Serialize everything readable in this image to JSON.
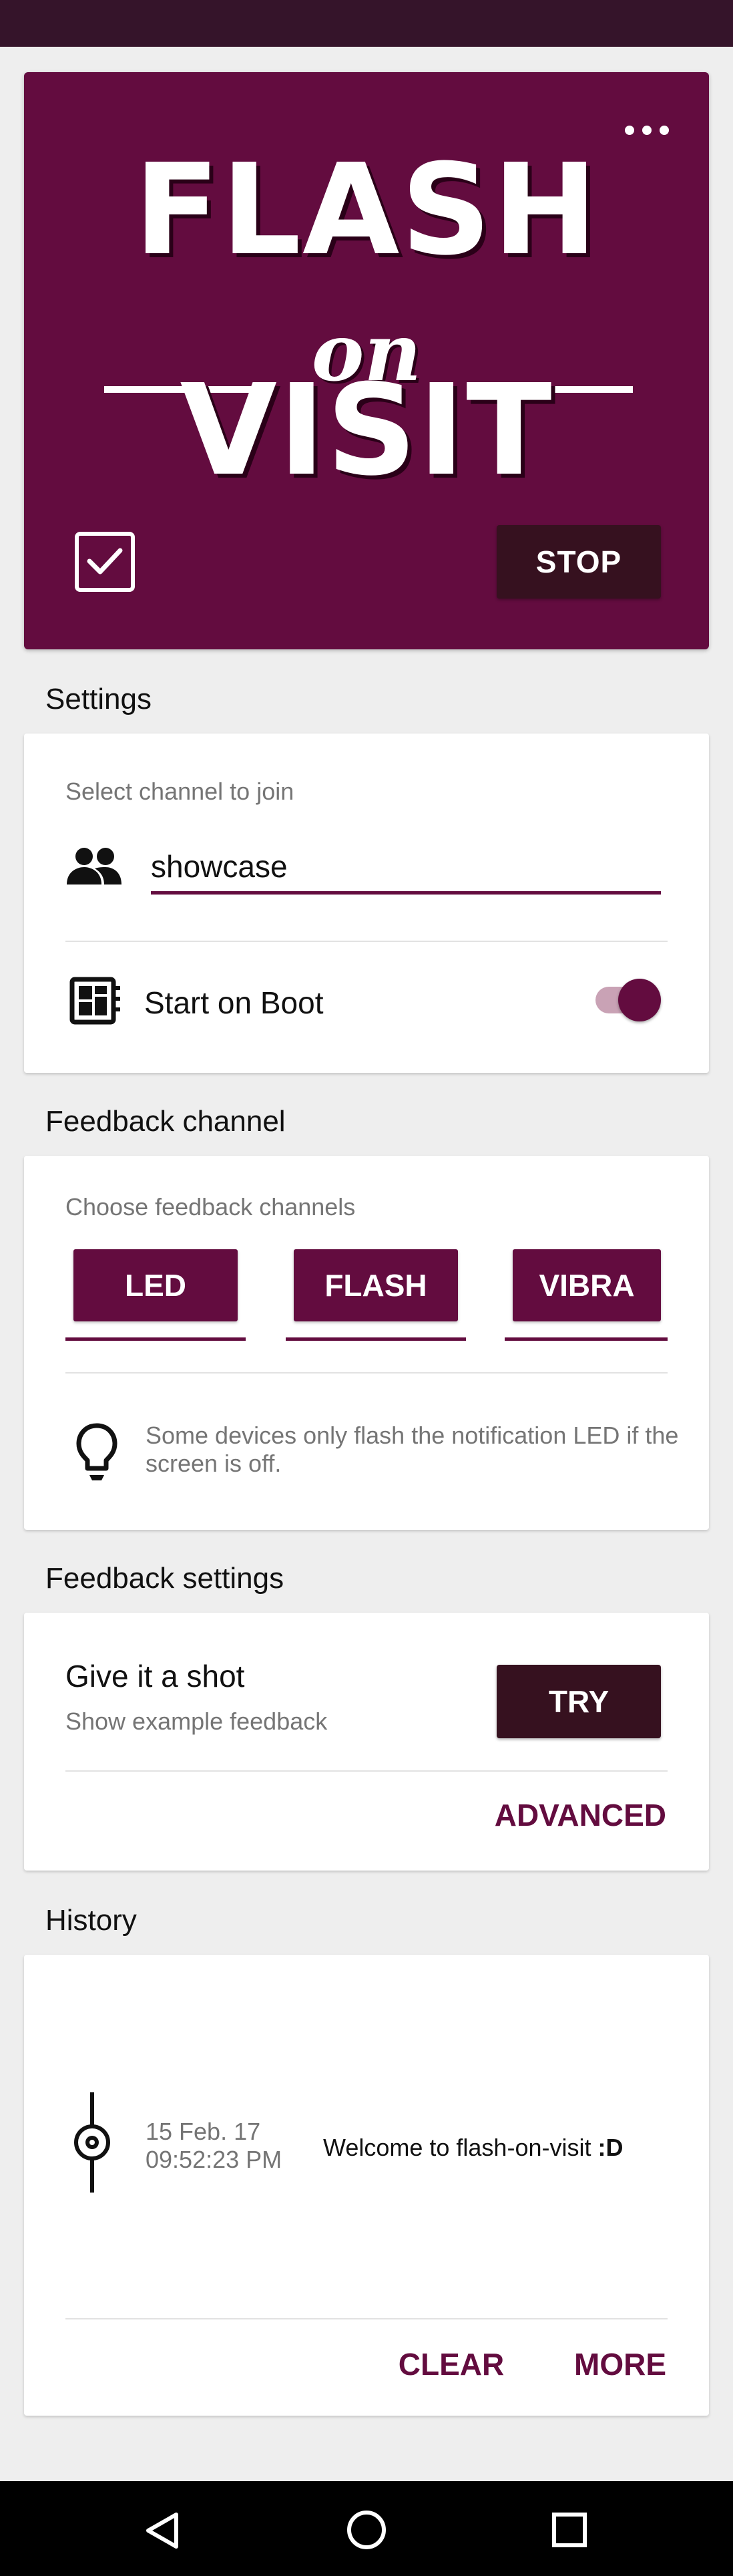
{
  "hero": {
    "logo_line1": "FLASH",
    "logo_line2": "on",
    "logo_line3": "VISIT",
    "stop_label": "STOP"
  },
  "settings": {
    "title": "Settings",
    "channel_caption": "Select channel to join",
    "channel_value": "showcase",
    "boot_label": "Start on Boot",
    "boot_enabled": true
  },
  "feedback_channel": {
    "title": "Feedback channel",
    "caption": "Choose feedback channels",
    "buttons": [
      "LED",
      "FLASH",
      "VIBRA"
    ],
    "hint": "Some devices only flash the notification LED if the screen is off."
  },
  "feedback_settings": {
    "title": "Feedback settings",
    "shot_title": "Give it a shot",
    "shot_subtitle": "Show example feedback",
    "try_label": "TRY",
    "advanced_label": "ADVANCED"
  },
  "history": {
    "title": "History",
    "entries": [
      {
        "date": "15 Feb. 17",
        "time": "09:52:23 PM",
        "message": "Welcome to flash-on-visit ",
        "message_emphasis": ":D"
      }
    ],
    "clear_label": "CLEAR",
    "more_label": "MORE"
  },
  "colors": {
    "primary": "#630c3f",
    "dark": "#36111f",
    "status_bar": "#35142a",
    "background": "#eeeeee"
  },
  "icons": [
    "more-dots-icon",
    "checkbox-icon",
    "group-icon",
    "boot-chip-icon",
    "lightbulb-icon",
    "history-node-icon",
    "back-icon",
    "home-icon",
    "recents-icon"
  ]
}
